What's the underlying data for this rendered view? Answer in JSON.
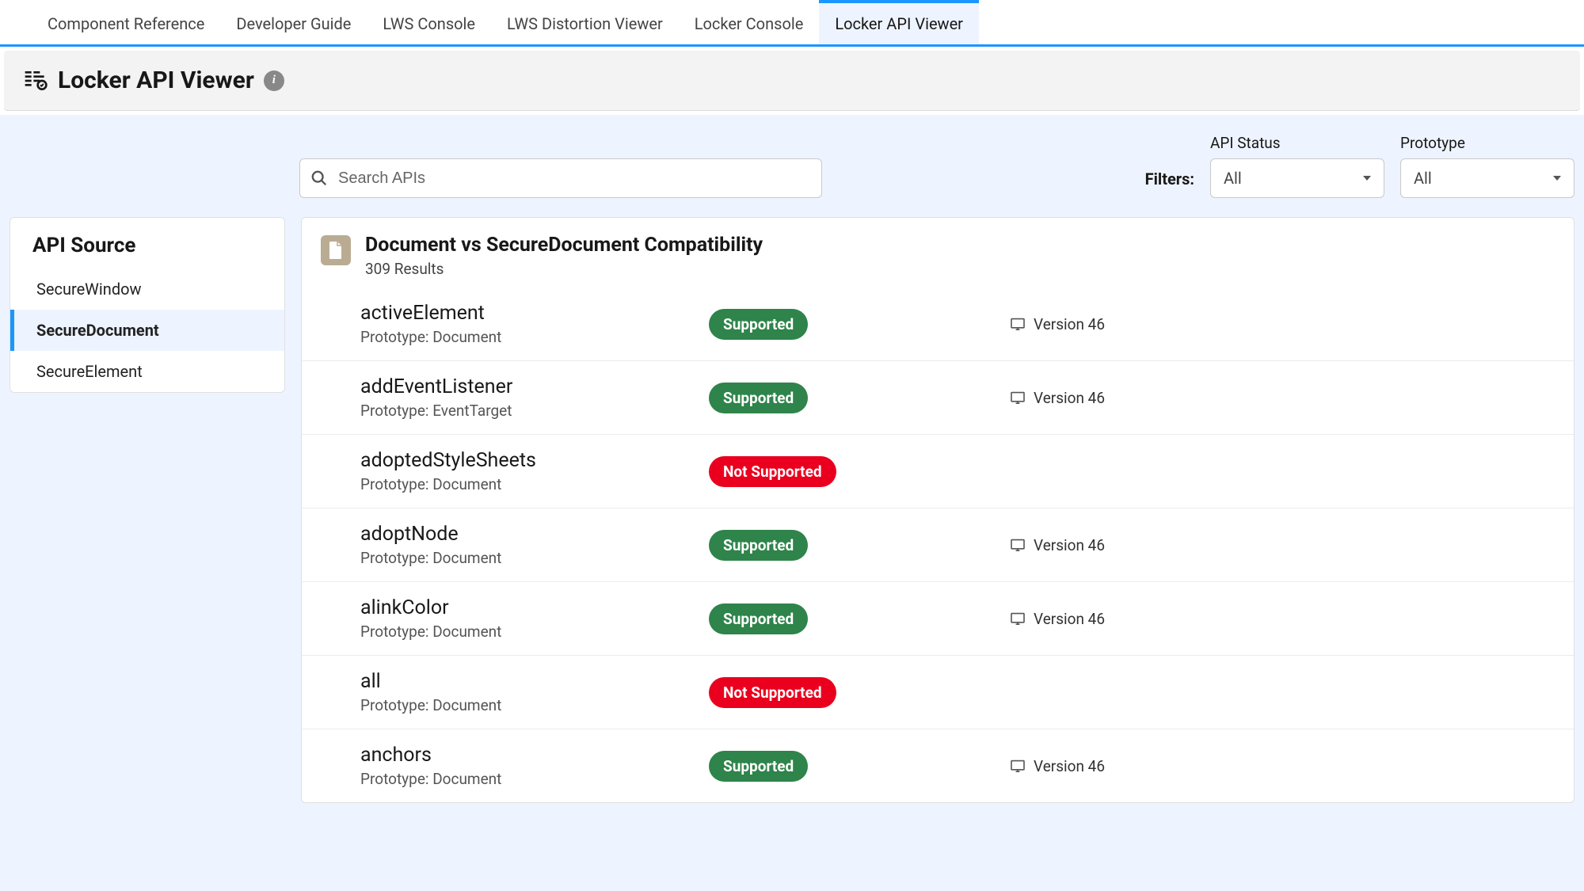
{
  "tabs": [
    {
      "label": "Component Reference"
    },
    {
      "label": "Developer Guide"
    },
    {
      "label": "LWS Console"
    },
    {
      "label": "LWS Distortion Viewer"
    },
    {
      "label": "Locker Console"
    },
    {
      "label": "Locker API Viewer"
    }
  ],
  "activeTabIndex": 5,
  "header": {
    "title": "Locker API Viewer"
  },
  "search": {
    "placeholder": "Search APIs"
  },
  "filters": {
    "label": "Filters:",
    "apiStatus": {
      "title": "API Status",
      "value": "All"
    },
    "prototype": {
      "title": "Prototype",
      "value": "All"
    }
  },
  "sidebar": {
    "title": "API Source",
    "items": [
      {
        "label": "SecureWindow"
      },
      {
        "label": "SecureDocument"
      },
      {
        "label": "SecureElement"
      }
    ],
    "activeIndex": 1
  },
  "panel": {
    "title": "Document vs SecureDocument Compatibility",
    "subtitle": "309 Results"
  },
  "apis": [
    {
      "name": "activeElement",
      "proto": "Prototype: Document",
      "status": "Supported",
      "version": "Version 46"
    },
    {
      "name": "addEventListener",
      "proto": "Prototype: EventTarget",
      "status": "Supported",
      "version": "Version 46"
    },
    {
      "name": "adoptedStyleSheets",
      "proto": "Prototype: Document",
      "status": "Not Supported",
      "version": ""
    },
    {
      "name": "adoptNode",
      "proto": "Prototype: Document",
      "status": "Supported",
      "version": "Version 46"
    },
    {
      "name": "alinkColor",
      "proto": "Prototype: Document",
      "status": "Supported",
      "version": "Version 46"
    },
    {
      "name": "all",
      "proto": "Prototype: Document",
      "status": "Not Supported",
      "version": ""
    },
    {
      "name": "anchors",
      "proto": "Prototype: Document",
      "status": "Supported",
      "version": "Version 46"
    }
  ]
}
